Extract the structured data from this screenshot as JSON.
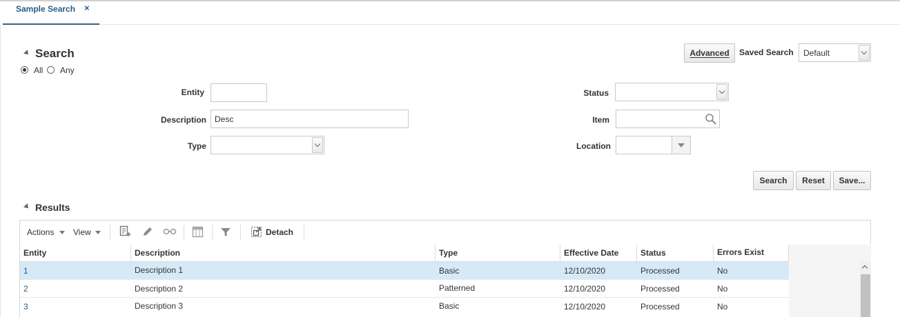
{
  "tab": {
    "label": "Sample Search",
    "close": "×"
  },
  "search": {
    "title": "Search",
    "match_all": "All",
    "match_any": "Any",
    "advanced_label": "Advanced",
    "saved_search_label": "Saved Search",
    "saved_search_value": "Default",
    "fields": {
      "entity_label": "Entity",
      "entity_value": "",
      "description_label": "Description",
      "description_value": "Desc",
      "type_label": "Type",
      "type_value": "",
      "status_label": "Status",
      "status_value": "",
      "item_label": "Item",
      "item_value": "",
      "location_label": "Location",
      "location_value": ""
    },
    "buttons": {
      "search": "Search",
      "reset": "Reset",
      "save": "Save..."
    }
  },
  "results": {
    "title": "Results",
    "toolbar": {
      "actions": "Actions",
      "view": "View",
      "detach": "Detach"
    },
    "columns": [
      "Entity",
      "Description",
      "Type",
      "Effective Date",
      "Status",
      "Errors Exist"
    ],
    "rows": [
      {
        "entity": "1",
        "description": "Description 1",
        "type": "Basic",
        "date": "12/10/2020",
        "status": "Processed",
        "errors": "No"
      },
      {
        "entity": "2",
        "description": "Description 2",
        "type": "Patterned",
        "date": "12/10/2020",
        "status": "Processed",
        "errors": "No"
      },
      {
        "entity": "3",
        "description": "Description 3",
        "type": "Basic",
        "date": "12/10/2020",
        "status": "Processed",
        "errors": "No"
      }
    ]
  }
}
